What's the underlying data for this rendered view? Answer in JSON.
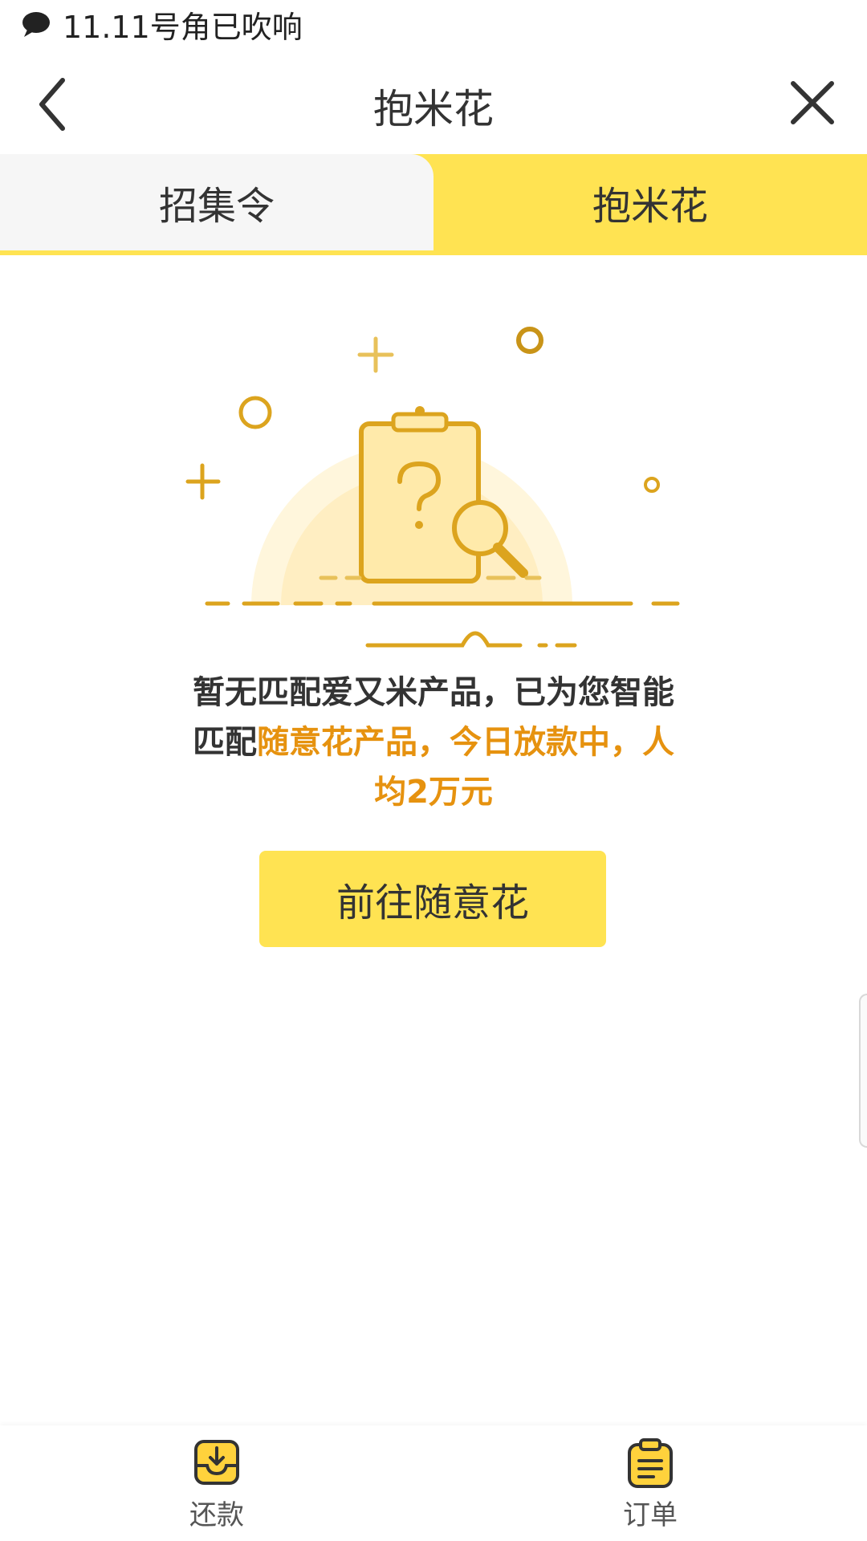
{
  "status_bar": {
    "notification_text": "11.11号角已吹响",
    "icon": "chat-bubble-icon"
  },
  "header": {
    "title": "抱米花",
    "back_icon": "chevron-left-icon",
    "close_icon": "close-icon"
  },
  "tabs": [
    {
      "label": "招集令",
      "active": false
    },
    {
      "label": "抱米花",
      "active": true
    }
  ],
  "empty_state": {
    "illustration_icon": "clipboard-search-icon",
    "message_plain": "暂无匹配爱又米产品，已为您智能匹配",
    "message_highlight": "随意花产品，今日放款中，人均2万元"
  },
  "cta_button": {
    "label": "前往随意花"
  },
  "bottom_nav": [
    {
      "label": "还款",
      "icon": "download-tray-icon"
    },
    {
      "label": "订单",
      "icon": "clipboard-list-icon"
    }
  ],
  "colors": {
    "accent_yellow": "#ffe352",
    "highlight_orange": "#e6920f",
    "illustration_gold": "#dca41e"
  }
}
